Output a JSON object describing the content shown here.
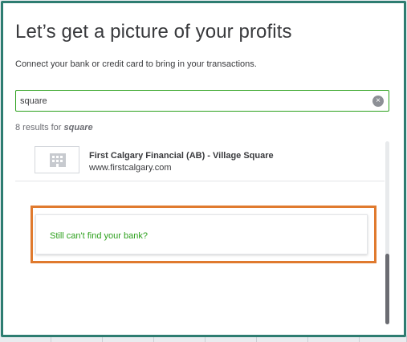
{
  "dialog": {
    "title": "Let’s get a picture of your profits",
    "subtitle": "Connect your bank or credit card to bring in your transactions."
  },
  "search": {
    "value": "square",
    "clear_icon": "×"
  },
  "results": {
    "count_prefix": "8 results for ",
    "count_term": "square",
    "items": [
      {
        "name": "First Calgary Financial (AB) - Village Square",
        "url": "www.firstcalgary.com"
      }
    ]
  },
  "cant_find": {
    "label": "Still can't find your bank?"
  },
  "colors": {
    "frame": "#2e7d71",
    "accent_green": "#2ca01c",
    "highlight_orange": "#e07a2e",
    "text": "#393a3d"
  }
}
